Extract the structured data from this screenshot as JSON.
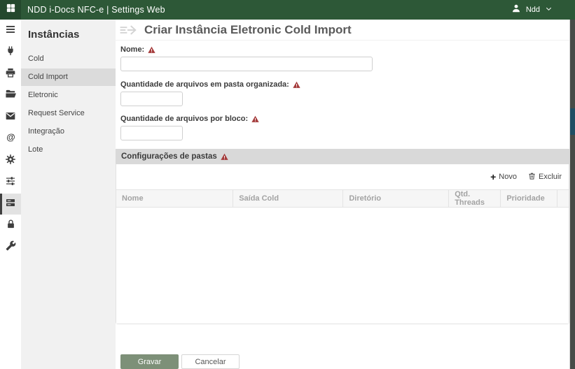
{
  "topbar": {
    "title": "NDD i-Docs NFC-e | Settings Web",
    "user_name": "Ndd",
    "icons": [
      "app-grid-icon",
      "user-icon",
      "chevron-down-icon"
    ]
  },
  "icon_rail": {
    "items": [
      {
        "icon": "menu-icon",
        "selected": false
      },
      {
        "icon": "plug-icon",
        "selected": false
      },
      {
        "icon": "printer-icon",
        "selected": false
      },
      {
        "icon": "folder-icon",
        "selected": false
      },
      {
        "icon": "mail-icon",
        "selected": false
      },
      {
        "icon": "at-icon",
        "selected": false
      },
      {
        "icon": "gear-icon",
        "selected": false
      },
      {
        "icon": "sliders-icon",
        "selected": false
      },
      {
        "icon": "server-icon",
        "selected": true
      },
      {
        "icon": "lock-icon",
        "selected": false
      },
      {
        "icon": "wrench-icon",
        "selected": false
      }
    ]
  },
  "sidebar": {
    "title": "Instâncias",
    "items": [
      {
        "label": "Cold",
        "selected": false
      },
      {
        "label": "Cold Import",
        "selected": true
      },
      {
        "label": "Eletronic",
        "selected": false
      },
      {
        "label": "Request Service",
        "selected": false
      },
      {
        "label": "Integração",
        "selected": false
      },
      {
        "label": "Lote",
        "selected": false
      }
    ]
  },
  "main": {
    "title": "Criar Instância Eletronic Cold Import",
    "title_icon": "import-lines-arrow-icon",
    "form": {
      "fields": [
        {
          "label": "Nome:",
          "value": "",
          "required": true
        },
        {
          "label": "Quantidade de arquivos em pasta organizada:",
          "value": "",
          "required": true
        },
        {
          "label": "Quantidade de arquivos por bloco:",
          "value": "",
          "required": true
        }
      ]
    },
    "panel": {
      "title": "Configurações de pastas",
      "required": true,
      "toolbar": {
        "new_label": "Novo",
        "new_icon": "plus-icon",
        "delete_label": "Excluir",
        "delete_icon": "trash-icon"
      },
      "table": {
        "columns": [
          "Nome",
          "Saída Cold",
          "Diretório",
          "Qtd. Threads",
          "Prioridade"
        ],
        "rows": []
      }
    },
    "actions": {
      "save_label": "Gravar",
      "cancel_label": "Cancelar"
    }
  },
  "colors": {
    "topbar_green": "#2d5837",
    "save_button_green": "#7d9078",
    "warning_red": "#a53c3c",
    "scrollbar_thumb_teal": "#1f4e63"
  }
}
